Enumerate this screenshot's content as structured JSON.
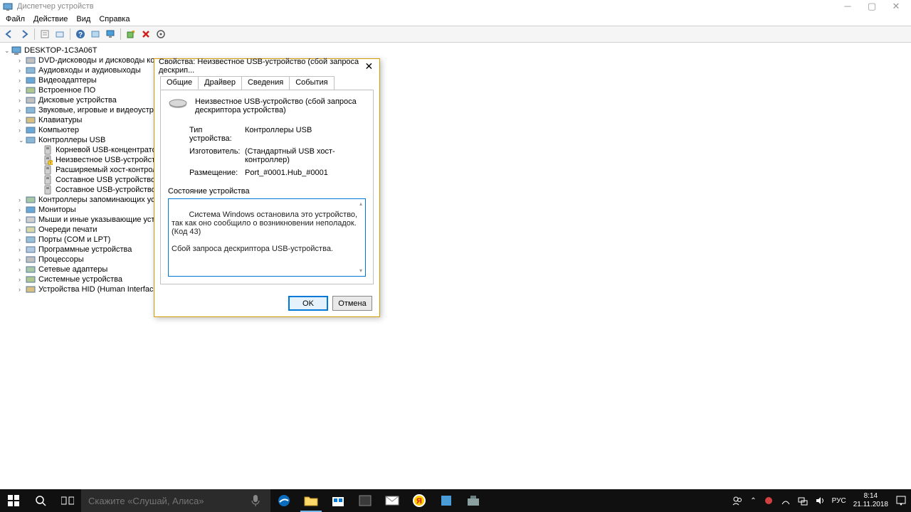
{
  "window": {
    "title": "Диспетчер устройств",
    "menu": {
      "file": "Файл",
      "action": "Действие",
      "view": "Вид",
      "help": "Справка"
    }
  },
  "toolbar": {
    "back": "назад",
    "fwd": "вперёд",
    "props": "свойства",
    "show": "показать",
    "help": "справка",
    "hw": "оборудование",
    "monitor": "монитор",
    "update": "обновить",
    "remove": "удалить",
    "rescan": "сканировать"
  },
  "tree": {
    "root": "DESKTOP-1C3A06T",
    "items": [
      "DVD-дисководы и дисководы компа",
      "Аудиовходы и аудиовыходы",
      "Видеоадаптеры",
      "Встроенное ПО",
      "Дисковые устройства",
      "Звуковые, игровые и видеоустройст",
      "Клавиатуры",
      "Компьютер",
      "Контроллеры USB",
      "Контроллеры запоминающих устро",
      "Мониторы",
      "Мыши и иные указывающие устрой",
      "Очереди печати",
      "Порты (COM и LPT)",
      "Программные устройства",
      "Процессоры",
      "Сетевые адаптеры",
      "Системные устройства",
      "Устройства HID (Human Interface Dev"
    ],
    "usb_children": [
      "Корневой USB-концентратор (USB",
      "Неизвестное USB-устройство (сбо",
      "Расширяемый хост-контроллер I",
      "Составное USB устройство",
      "Составное USB-устройство"
    ]
  },
  "dialog": {
    "title": "Свойства: Неизвестное USB-устройство (сбой запроса дескрип...",
    "tabs": {
      "general": "Общие",
      "driver": "Драйвер",
      "details": "Сведения",
      "events": "События"
    },
    "device_name": "Неизвестное USB-устройство (сбой запроса дескриптора устройства)",
    "type_label": "Тип устройства:",
    "type_value": "Контроллеры USB",
    "manu_label": "Изготовитель:",
    "manu_value": "(Стандартный USB хост-контроллер)",
    "loc_label": "Размещение:",
    "loc_value": "Port_#0001.Hub_#0001",
    "status_label": "Состояние устройства",
    "status_text": "Система Windows остановила это устройство, так как оно сообщило о возникновении неполадок. (Код 43)\n\nСбой запроса дескриптора USB-устройства.",
    "ok": "OK",
    "cancel": "Отмена"
  },
  "taskbar": {
    "search_placeholder": "Скажите «Слушай, Алиса»",
    "lang": "РУС",
    "time": "8:14",
    "date": "21.11.2018"
  }
}
